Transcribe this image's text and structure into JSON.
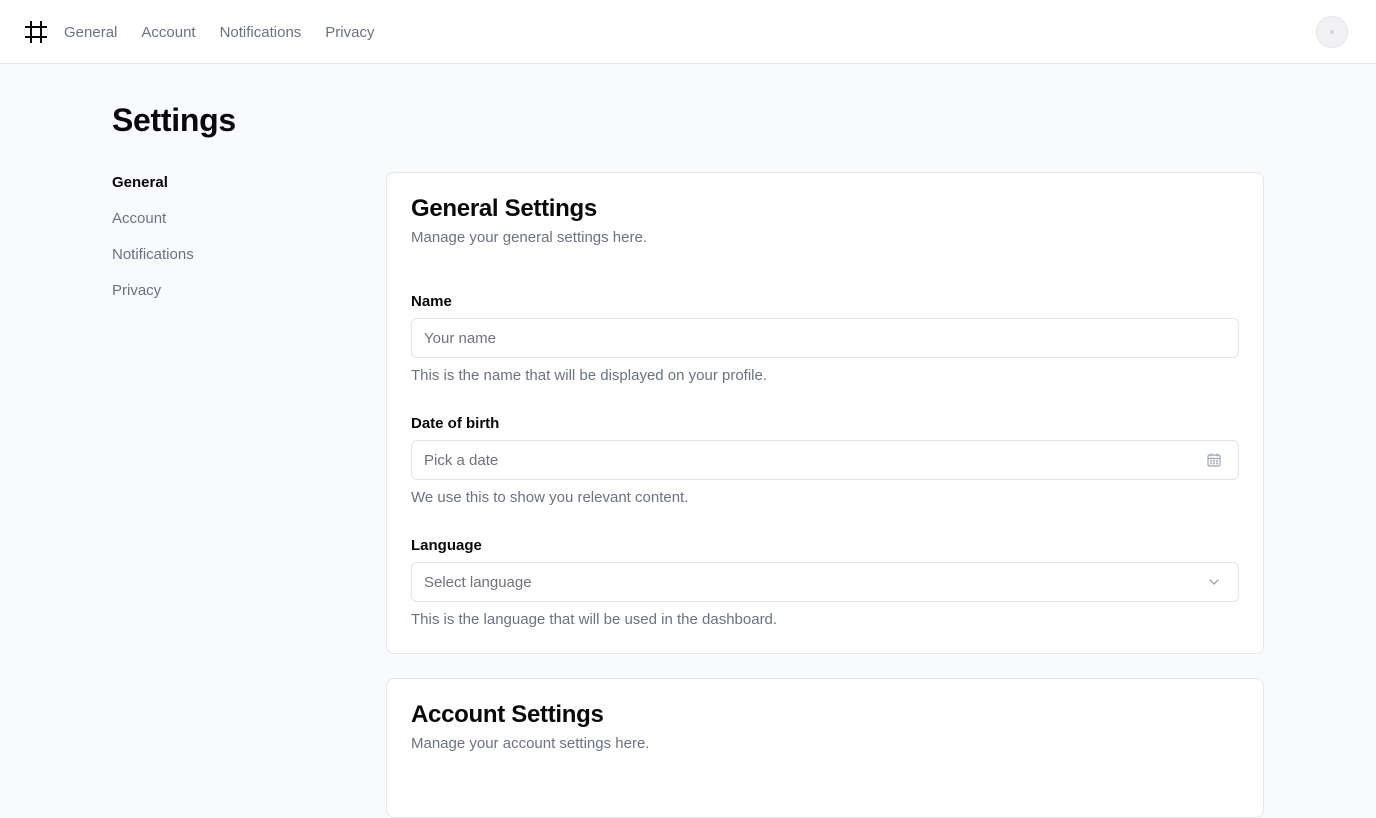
{
  "topbar": {
    "logo_icon": "hash-grid-icon",
    "nav": [
      "General",
      "Account",
      "Notifications",
      "Privacy"
    ],
    "avatar_icon": "avatar-placeholder"
  },
  "page": {
    "title": "Settings"
  },
  "sidebar": {
    "items": [
      {
        "label": "General",
        "active": true
      },
      {
        "label": "Account",
        "active": false
      },
      {
        "label": "Notifications",
        "active": false
      },
      {
        "label": "Privacy",
        "active": false
      }
    ]
  },
  "general_card": {
    "title": "General Settings",
    "description": "Manage your general settings here.",
    "name": {
      "label": "Name",
      "placeholder": "Your name",
      "value": "",
      "help": "This is the name that will be displayed on your profile."
    },
    "dob": {
      "label": "Date of birth",
      "placeholder": "Pick a date",
      "icon": "calendar-icon",
      "help": "We use this to show you relevant content."
    },
    "language": {
      "label": "Language",
      "placeholder": "Select language",
      "icon": "chevron-down-icon",
      "help": "This is the language that will be used in the dashboard."
    }
  },
  "account_card": {
    "title": "Account Settings",
    "description": "Manage your account settings here."
  },
  "colors": {
    "page_bg": "#f9fafb",
    "card_bg": "#ffffff",
    "border": "#e5e7eb",
    "text": "#09090b",
    "muted": "#6b7280"
  }
}
